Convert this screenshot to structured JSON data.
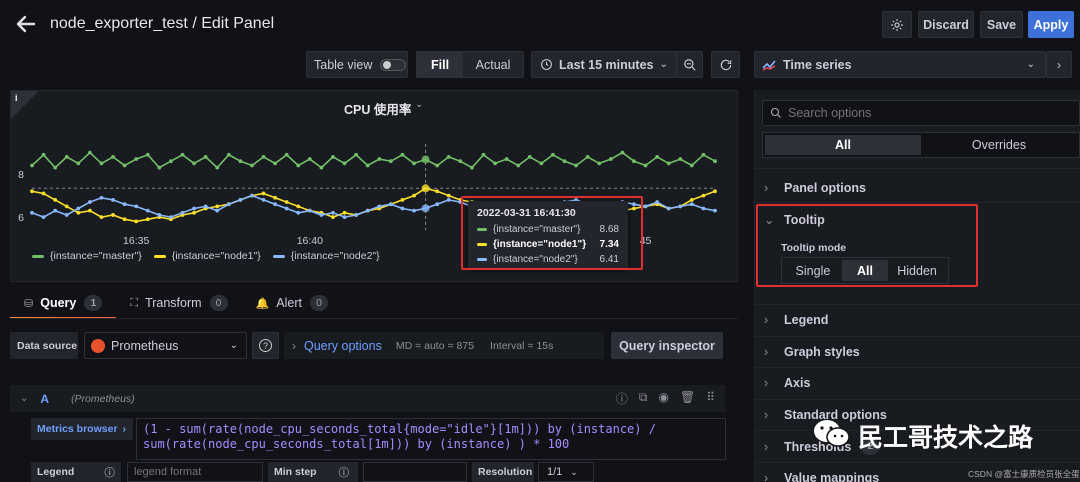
{
  "header": {
    "title": "node_exporter_test / Edit Panel",
    "discard_label": "Discard",
    "save_label": "Save",
    "apply_label": "Apply"
  },
  "toolbar": {
    "table_view_label": "Table view",
    "fill_label": "Fill",
    "actual_label": "Actual",
    "time_range_label": "Last 15 minutes",
    "visualization_label": "Time series"
  },
  "panel": {
    "info_glyph": "i",
    "title": "CPU 使用率",
    "y_ticks": [
      "8",
      "6"
    ],
    "x_ticks": [
      "16:35",
      "16:40",
      "45"
    ],
    "legend": [
      {
        "label": "{instance=\"master\"}",
        "color": "#73bf69"
      },
      {
        "label": "{instance=\"node1\"}",
        "color": "#fade2a"
      },
      {
        "label": "{instance=\"node2\"}",
        "color": "#8ab8ff"
      }
    ],
    "tooltip": {
      "time": "2022-03-31 16:41:30",
      "rows": [
        {
          "label": "{instance=\"master\"}",
          "value": "8.68",
          "color": "#73bf69"
        },
        {
          "label": "{instance=\"node1\"}",
          "value": "7.34",
          "color": "#fade2a"
        },
        {
          "label": "{instance=\"node2\"}",
          "value": "6.41",
          "color": "#8ab8ff"
        }
      ]
    }
  },
  "chart_data": {
    "type": "line",
    "series": [
      {
        "name": "{instance=\"master\"}",
        "color": "#73bf69",
        "values": [
          8.4,
          8.9,
          8.3,
          8.8,
          8.5,
          9.0,
          8.5,
          8.8,
          8.4,
          8.7,
          8.9,
          8.3,
          8.6,
          8.9,
          8.5,
          8.8,
          8.3,
          8.9,
          8.6,
          8.4,
          8.8,
          8.5,
          8.9,
          8.4,
          8.7,
          8.3,
          8.8,
          8.5,
          8.9,
          8.4,
          8.7,
          8.6,
          8.9,
          8.5,
          8.68,
          8.4,
          8.8,
          8.6,
          8.3,
          8.9,
          8.5,
          8.7,
          8.4,
          8.8,
          8.5,
          8.9,
          8.6,
          8.4,
          8.8,
          8.5,
          8.7,
          9.0,
          8.6,
          8.4,
          8.8,
          8.5,
          8.7,
          8.4,
          8.9,
          8.6
        ]
      },
      {
        "name": "{instance=\"node1\"}",
        "color": "#fade2a",
        "values": [
          7.2,
          7.1,
          6.8,
          6.5,
          6.2,
          6.3,
          6.0,
          6.1,
          5.9,
          5.8,
          5.9,
          6.0,
          5.9,
          6.1,
          6.2,
          6.4,
          6.5,
          6.6,
          6.8,
          7.0,
          7.1,
          6.9,
          6.7,
          6.5,
          6.3,
          6.2,
          6.0,
          6.2,
          6.1,
          6.3,
          6.4,
          6.6,
          6.8,
          7.0,
          7.34,
          7.2,
          7.0,
          6.8,
          6.7,
          6.6,
          6.5,
          6.4,
          6.5,
          6.3,
          6.4,
          6.5,
          6.6,
          6.5,
          6.4,
          6.6,
          6.5,
          6.3,
          6.4,
          6.5,
          6.6,
          6.4,
          6.5,
          6.8,
          7.0,
          7.2
        ]
      },
      {
        "name": "{instance=\"node2\"}",
        "color": "#8ab8ff",
        "values": [
          6.2,
          6.0,
          6.3,
          6.1,
          6.4,
          6.7,
          6.9,
          6.8,
          6.6,
          6.5,
          6.3,
          6.1,
          6.0,
          6.2,
          6.4,
          6.5,
          6.3,
          6.6,
          6.8,
          7.0,
          6.8,
          6.6,
          6.4,
          6.2,
          6.3,
          6.1,
          6.2,
          6.0,
          6.1,
          6.3,
          6.5,
          6.6,
          6.4,
          6.3,
          6.41,
          6.6,
          6.8,
          6.7,
          6.5,
          6.4,
          6.3,
          6.5,
          6.2,
          6.4,
          6.6,
          6.5,
          6.7,
          6.8,
          6.6,
          6.4,
          6.5,
          6.7,
          6.6,
          6.5,
          6.7,
          6.4,
          6.5,
          6.6,
          6.4,
          6.3
        ]
      }
    ],
    "ylim": [
      5.4,
      9.4
    ],
    "x_ticks": [
      "16:35",
      "16:40",
      "45"
    ]
  },
  "query_tabs": [
    {
      "label": "Query",
      "count": "1",
      "icon": "database-icon",
      "active": true
    },
    {
      "label": "Transform",
      "count": "0",
      "icon": "transform-icon",
      "active": false
    },
    {
      "label": "Alert",
      "count": "0",
      "icon": "bell-icon",
      "active": false
    }
  ],
  "query_bar": {
    "data_source_label": "Data source",
    "data_source_value": "Prometheus",
    "query_options_label": "Query options",
    "md_label": "MD = auto = 875",
    "interval_label": "Interval = 15s",
    "query_inspector_label": "Query inspector"
  },
  "query_row": {
    "letter": "A",
    "source": "(Prometheus)",
    "metrics_browser_label": "Metrics browser",
    "expr_line1": "(1 - sum(rate(node_cpu_seconds_total{mode=\"idle\"}[1m])) by (instance) /",
    "expr_line2": "sum(rate(node_cpu_seconds_total[1m])) by (instance) ) * 100",
    "legend_label": "Legend",
    "legend_placeholder": "legend format",
    "min_step_label": "Min step",
    "resolution_label": "Resolution",
    "resolution_value": "1/1"
  },
  "options_pane": {
    "search_placeholder": "Search options",
    "tab_all": "All",
    "tab_overrides": "Overrides",
    "panel_options": "Panel options",
    "tooltip_title": "Tooltip",
    "tooltip_mode_label": "Tooltip mode",
    "tooltip_modes": [
      "Single",
      "All",
      "Hidden"
    ],
    "sections": [
      "Legend",
      "Graph styles",
      "Axis",
      "Standard options",
      "Thresholds",
      "Value mappings"
    ],
    "thresholds_count": "2"
  },
  "watermark": {
    "brand": "民工哥技术之路",
    "credit": "CSDN @富士康质检员张全蛋"
  }
}
